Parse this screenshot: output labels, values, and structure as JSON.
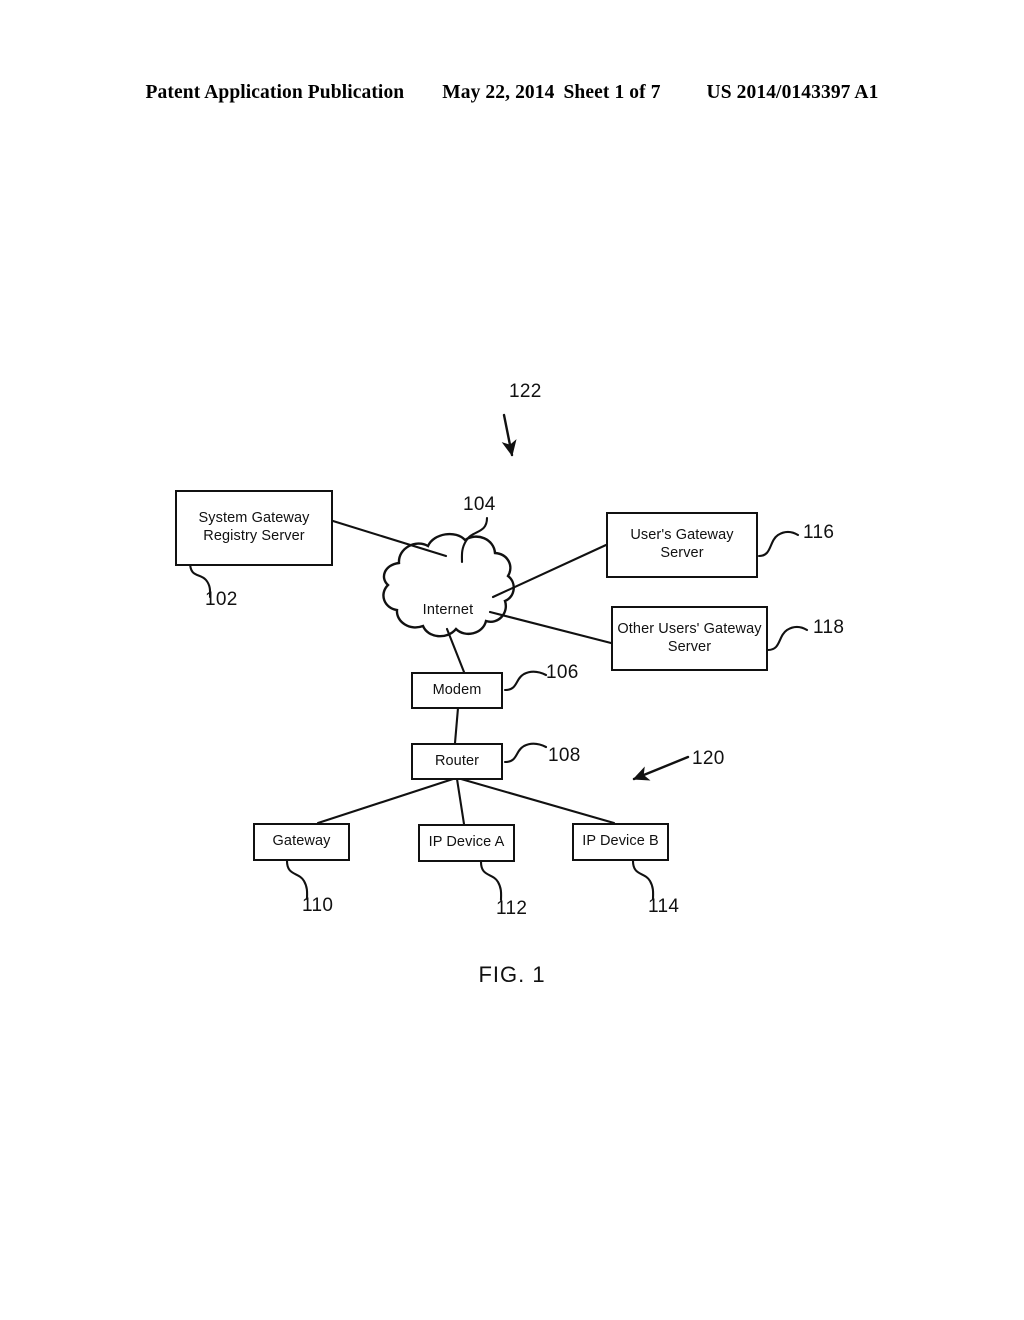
{
  "header": {
    "publication": "Patent Application Publication",
    "date": "May 22, 2014",
    "sheet": "Sheet 1 of 7",
    "patent_number": "US 2014/0143397 A1"
  },
  "figure": {
    "caption": "FIG. 1",
    "system_ref": "122",
    "local_network_ref": "120"
  },
  "nodes": {
    "system_gateway_registry_server": {
      "label": "System Gateway\nRegistry Server",
      "ref": "102"
    },
    "internet": {
      "label": "Internet",
      "ref": "104"
    },
    "modem": {
      "label": "Modem",
      "ref": "106"
    },
    "router": {
      "label": "Router",
      "ref": "108"
    },
    "gateway": {
      "label": "Gateway",
      "ref": "110"
    },
    "ip_device_a": {
      "label": "IP Device A",
      "ref": "112"
    },
    "ip_device_b": {
      "label": "IP Device B",
      "ref": "114"
    },
    "users_gateway_server": {
      "label": "User's Gateway\nServer",
      "ref": "116"
    },
    "other_users_gateway_server": {
      "label": "Other Users' Gateway\nServer",
      "ref": "118"
    }
  },
  "connections": [
    {
      "from": "system_gateway_registry_server",
      "to": "internet"
    },
    {
      "from": "internet",
      "to": "users_gateway_server"
    },
    {
      "from": "internet",
      "to": "other_users_gateway_server"
    },
    {
      "from": "internet",
      "to": "modem"
    },
    {
      "from": "modem",
      "to": "router"
    },
    {
      "from": "router",
      "to": "gateway"
    },
    {
      "from": "router",
      "to": "ip_device_a"
    },
    {
      "from": "router",
      "to": "ip_device_b"
    }
  ],
  "colors": {
    "ink": "#111111",
    "paper": "#ffffff"
  }
}
